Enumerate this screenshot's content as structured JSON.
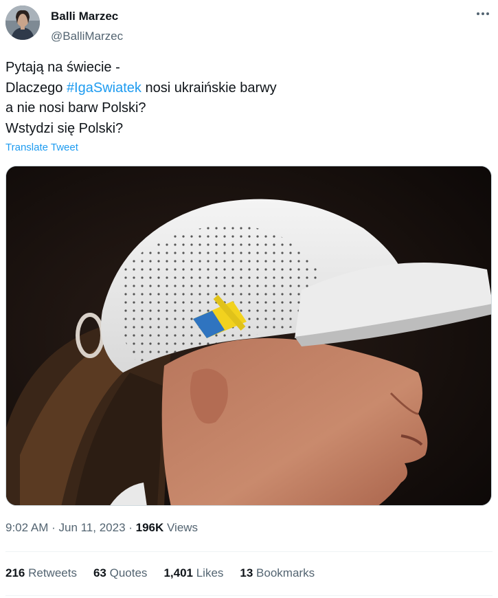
{
  "author": {
    "display_name": "Balli Marzec",
    "handle": "@BalliMarzec",
    "avatar_icon": "avatar-portrait",
    "more_icon": "more-options-icon"
  },
  "tweet": {
    "line1": "Pytają na świecie -",
    "line2_prefix": "Dlaczego ",
    "hashtag": "#IgaSwiatek",
    "line2_suffix": " nosi ukraińskie barwy",
    "line3": "a nie nosi barw Polski?",
    "line4": "Wstydzi się Polski?",
    "translate_label": "Translate Tweet"
  },
  "meta": {
    "time": "9:02 AM",
    "sep1": " · ",
    "date": "Jun 11, 2023",
    "sep2": " · ",
    "views_count": "196K",
    "views_label": " Views"
  },
  "stats": {
    "retweets_count": "216",
    "retweets_label": " Retweets",
    "quotes_count": "63",
    "quotes_label": " Quotes",
    "likes_count": "1,401",
    "likes_label": " Likes",
    "bookmarks_count": "13",
    "bookmarks_label": " Bookmarks"
  },
  "colors": {
    "link": "#1d9bf0",
    "text": "#0f1419",
    "secondary": "#536471",
    "divider": "#eff3f4"
  }
}
